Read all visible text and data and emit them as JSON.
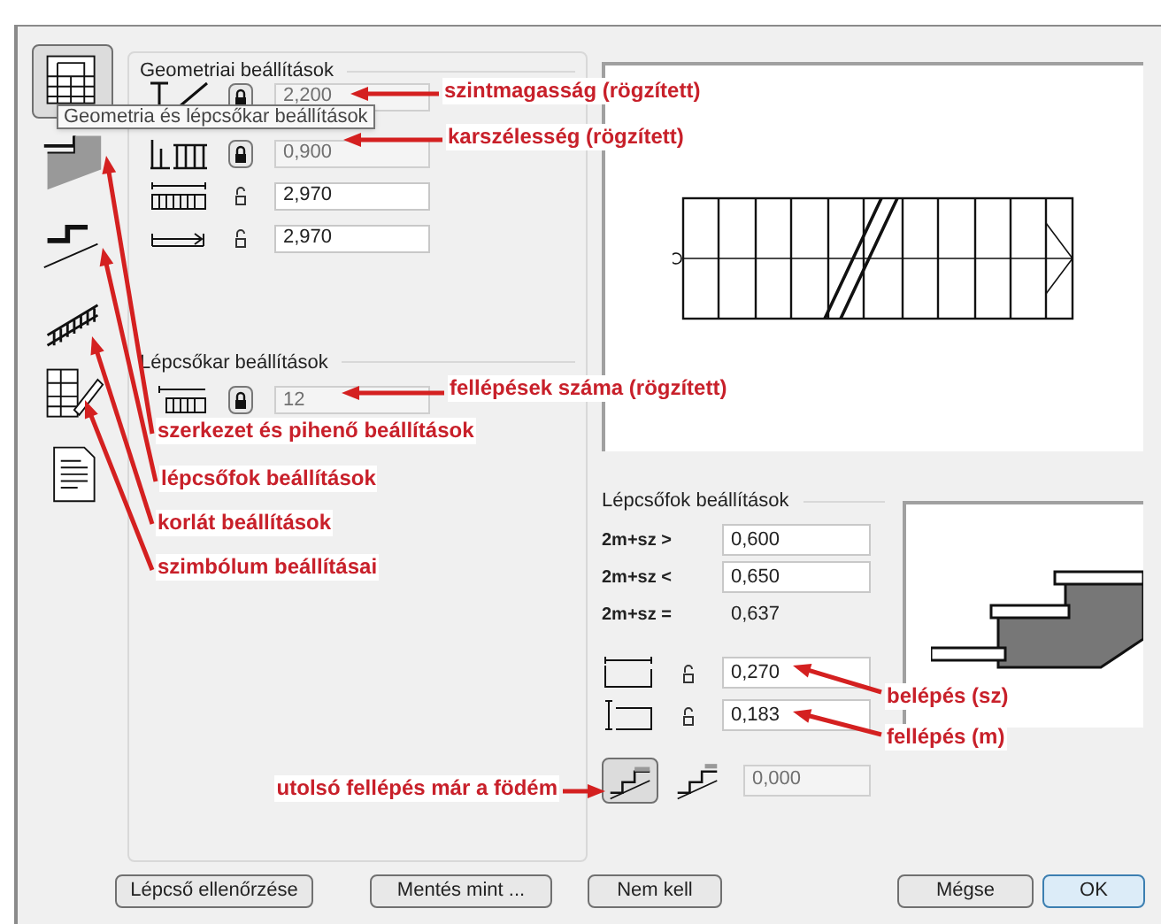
{
  "sidebar": {
    "items": [
      {
        "kind": "geometry",
        "selected": true
      },
      {
        "kind": "structure",
        "selected": false
      },
      {
        "kind": "treads",
        "selected": false
      },
      {
        "kind": "railing",
        "selected": false
      },
      {
        "kind": "symbol",
        "selected": false
      },
      {
        "kind": "listing",
        "selected": false
      }
    ]
  },
  "tooltip": "Geometria és lépcsőkar beállítások",
  "geometry": {
    "title": "Geometriai beállítások",
    "rows": [
      {
        "kind": "height",
        "locked": true,
        "value": "2,200"
      },
      {
        "kind": "width",
        "locked": true,
        "value": "0,900"
      },
      {
        "kind": "length",
        "locked": false,
        "value": "2,970"
      },
      {
        "kind": "run",
        "locked": false,
        "value": "2,970"
      }
    ]
  },
  "flight": {
    "title": "Lépcsőkar beállítások",
    "rows": [
      {
        "kind": "risers",
        "locked": true,
        "value": "12"
      }
    ]
  },
  "treads": {
    "title": "Lépcsőfok beállítások",
    "rules": [
      {
        "kind": "field",
        "label": "2m+sz >",
        "value": "0,600"
      },
      {
        "kind": "field",
        "label": "2m+sz <",
        "value": "0,650"
      },
      {
        "kind": "readout",
        "label": "2m+sz =",
        "value": "0,637"
      }
    ],
    "dims": [
      {
        "kind": "tread",
        "locked": false,
        "value": "0,270"
      },
      {
        "kind": "riser",
        "locked": false,
        "value": "0,183"
      }
    ],
    "last_step": {
      "options": [
        {
          "kind": "slab",
          "selected": true
        },
        {
          "kind": "step",
          "selected": false
        }
      ],
      "value": "0,000"
    }
  },
  "buttons": [
    {
      "label": "Lépcső ellenőrzése",
      "default": false
    },
    {
      "label": "Mentés mint ...",
      "default": false
    },
    {
      "label": "Nem kell",
      "default": false
    },
    {
      "label": "Mégse",
      "default": false
    },
    {
      "label": "OK",
      "default": true
    }
  ],
  "annotations": [
    {
      "text": "szintmagasság (rögzített)"
    },
    {
      "text": "karszélesség (rögzített)"
    },
    {
      "text": "fellépések száma (rögzített)"
    },
    {
      "text": "szerkezet és pihenő beállítások"
    },
    {
      "text": "lépcsőfok beállítások"
    },
    {
      "text": "korlát beállítások"
    },
    {
      "text": "szimbólum beállításai"
    },
    {
      "text": "belépés (sz)"
    },
    {
      "text": "fellépés (m)"
    },
    {
      "text": "utolsó fellépés már a födém"
    }
  ]
}
